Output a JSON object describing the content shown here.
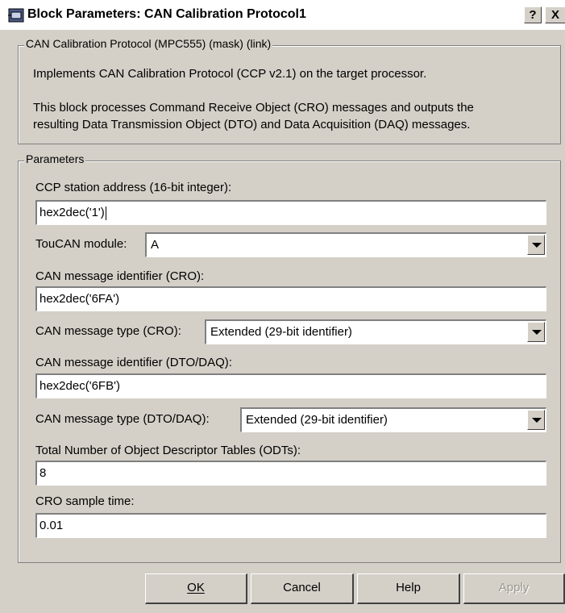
{
  "window": {
    "title": "Block Parameters: CAN Calibration Protocol1",
    "help_glyph": "?",
    "close_glyph": "X"
  },
  "mask_group": {
    "label": "CAN Calibration Protocol (MPC555) (mask) (link)",
    "line1": "Implements CAN Calibration Protocol (CCP v2.1) on the target processor.",
    "line2": "This block processes Command Receive Object (CRO) messages and outputs the",
    "line3": "resulting Data Transmission Object (DTO) and Data Acquisition (DAQ) messages."
  },
  "params_group": {
    "label": "Parameters",
    "station_address": {
      "label": "CCP station address (16-bit integer):",
      "value": "hex2dec('1')"
    },
    "toucan": {
      "label": "TouCAN module:",
      "value": "A"
    },
    "cro_id": {
      "label": "CAN message identifier (CRO):",
      "value": "hex2dec('6FA')"
    },
    "cro_type": {
      "label": "CAN message type (CRO):",
      "value": "Extended (29-bit identifier)"
    },
    "dto_id": {
      "label": "CAN message identifier (DTO/DAQ):",
      "value": "hex2dec('6FB')"
    },
    "dto_type": {
      "label": "CAN message type (DTO/DAQ):",
      "value": "Extended (29-bit identifier)"
    },
    "odt_count": {
      "label": "Total Number of Object Descriptor Tables (ODTs):",
      "value": "8"
    },
    "sample_time": {
      "label": "CRO sample time:",
      "value": "0.01"
    }
  },
  "buttons": {
    "ok": "OK",
    "cancel": "Cancel",
    "help": "Help",
    "apply": "Apply"
  },
  "colors": {
    "dialog_bg": "#d4d0c8",
    "disabled_text": "#9a968e"
  }
}
